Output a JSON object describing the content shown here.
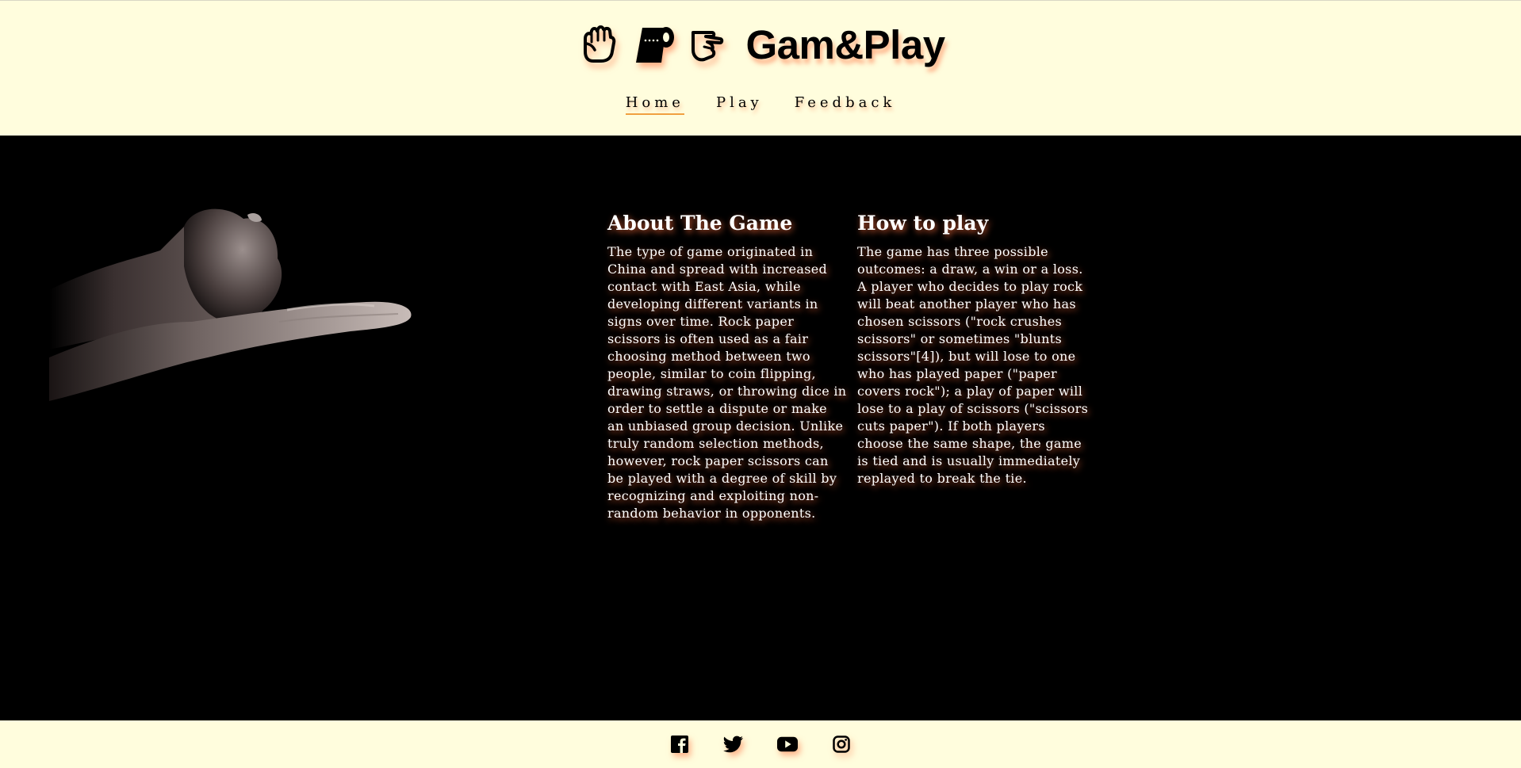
{
  "header": {
    "logo_icons": [
      "rock-fist-icon",
      "paper-roll-icon",
      "scissors-hand-icon"
    ],
    "title": "Gam&Play",
    "nav": [
      {
        "label": "Home",
        "active": true
      },
      {
        "label": "Play",
        "active": false
      },
      {
        "label": "Feedback",
        "active": false
      }
    ]
  },
  "main": {
    "hero_image": "hands-rock-paper-scissors-photo",
    "about": {
      "title": "About The Game",
      "body": "The type of game originated in China and spread with increased contact with East Asia, while developing different variants in signs over time. Rock paper scissors is often used as a fair choosing method between two people, similar to coin flipping, drawing straws, or throwing dice in order to settle a dispute or make an unbiased group decision. Unlike truly random selection methods, however, rock paper scissors can be played with a degree of skill by recognizing and exploiting non-random behavior in opponents."
    },
    "howto": {
      "title": "How to play",
      "body": "The game has three possible outcomes: a draw, a win or a loss. A player who decides to play rock will beat another player who has chosen scissors (\"rock crushes scissors\" or sometimes \"blunts scissors\"[4]), but will lose to one who has played paper (\"paper covers rock\"); a play of paper will lose to a play of scissors (\"scissors cuts paper\"). If both players choose the same shape, the game is tied and is usually immediately replayed to break the tie."
    }
  },
  "footer": {
    "social_icons": [
      "facebook-icon",
      "twitter-icon",
      "youtube-icon",
      "instagram-icon"
    ]
  },
  "colors": {
    "cream": "#fffddd",
    "accent_underline": "#f0a040",
    "glow": "#ff6e3c",
    "background": "#000000"
  }
}
